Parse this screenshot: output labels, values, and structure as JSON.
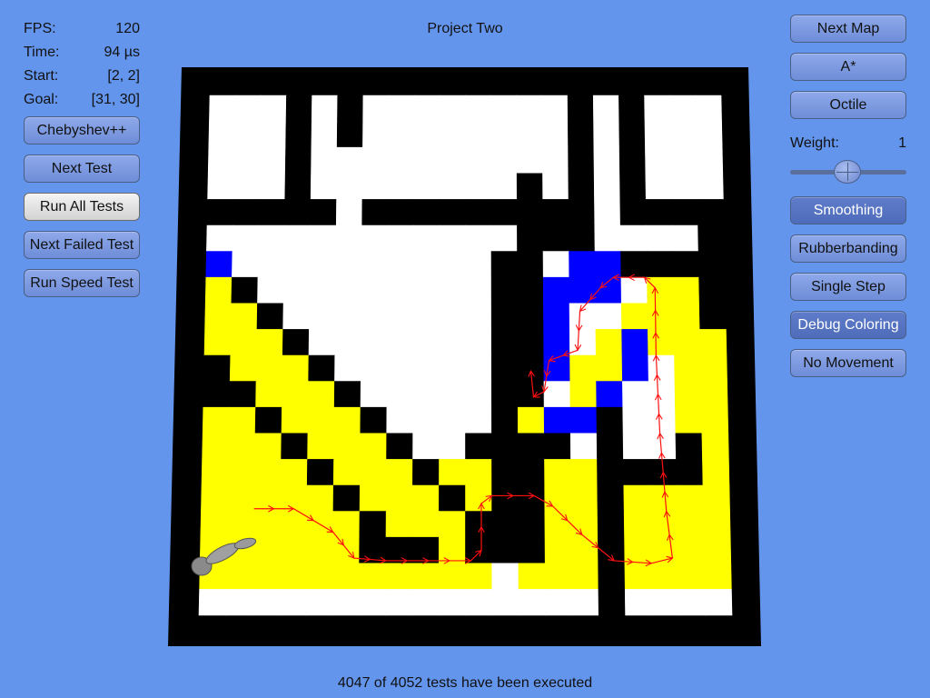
{
  "window": {
    "title": "Project Two"
  },
  "stats": [
    {
      "label": "FPS:",
      "value": "120"
    },
    {
      "label": "Time:",
      "value": "94 µs"
    },
    {
      "label": "Start:",
      "value": "[2, 2]"
    },
    {
      "label": "Goal:",
      "value": "[31, 30]"
    }
  ],
  "left_buttons": {
    "heuristic": "Chebyshev++",
    "next_test": "Next Test",
    "run_all_tests": "Run All Tests",
    "next_failed_test": "Next Failed Test",
    "run_speed_test": "Run Speed Test"
  },
  "right_panel": {
    "next_map": "Next Map",
    "algorithm": "A*",
    "heuristic_mode": "Octile",
    "weight_label": "Weight:",
    "weight_value": "1",
    "weight_slider_fraction": 0.43,
    "smoothing": "Smoothing",
    "rubberbanding": "Rubberbanding",
    "single_step": "Single Step",
    "debug_coloring": "Debug Coloring",
    "no_movement": "No Movement"
  },
  "status": {
    "text": "4047 of 4052 tests have been executed"
  },
  "colors": {
    "background": "#6495ed",
    "wall": "#000000",
    "open": "#ffffff",
    "closed": "#ffff00",
    "frontier": "#0000ff",
    "path": "#ff1010"
  },
  "grid": {
    "size": 20,
    "walls": [
      "14,0",
      "14,1",
      "14,2",
      "14,3",
      "14,4",
      "14,5",
      "12,3",
      "12,4",
      "12,5",
      "12,6",
      "12,7",
      "12,8",
      "12,9",
      "12,10",
      "12,11",
      "16,0",
      "16,1",
      "16,2",
      "16,3",
      "16,4",
      "11,6",
      "11,7",
      "11,8",
      "11,9",
      "11,10",
      "11,11",
      "11,12",
      "11,13",
      "11,14",
      "11,15",
      "11,16",
      "11,17",
      "12,14",
      "12,15",
      "12,16",
      "12,17",
      "10,16",
      "10,17",
      "15,12",
      "15,13",
      "15,14",
      "15,15",
      "15,16",
      "15,17",
      "15,18",
      "15,19",
      "16,6",
      "17,6",
      "18,6",
      "19,6",
      "19,7",
      "19,8",
      "3,0",
      "3,1",
      "3,2",
      "3,3",
      "3,4",
      "0,4",
      "1,4",
      "2,4",
      "3,4",
      "4,4",
      "6,4",
      "7,4",
      "8,4",
      "9,4",
      "10,4",
      "11,4",
      "12,4",
      "13,4",
      "14,4",
      "12,5",
      "13,5",
      "5,0",
      "5,1",
      "17,4",
      "18,4",
      "19,4",
      "19,5",
      "1,7",
      "2,8",
      "3,9",
      "4,10",
      "5,11",
      "6,12",
      "7,13",
      "8,14",
      "9,15",
      "0,10",
      "1,11",
      "2,12",
      "3,13",
      "4,14",
      "5,15",
      "6,16",
      "6,17",
      "7,17",
      "8,17",
      "6,16",
      "8,17",
      "10,13",
      "11,13",
      "12,13",
      "13,13",
      "18,13",
      "18,14",
      "17,14",
      "16,14",
      "0,11"
    ],
    "closed": [
      "0,7",
      "0,8",
      "0,9",
      "0,11",
      "0,12",
      "0,13",
      "0,14",
      "0,15",
      "0,16",
      "0,17",
      "0,18",
      "1,8",
      "1,9",
      "1,10",
      "1,12",
      "1,13",
      "1,14",
      "1,15",
      "1,16",
      "1,17",
      "1,18",
      "2,9",
      "2,10",
      "2,11",
      "2,13",
      "2,14",
      "2,15",
      "2,16",
      "2,17",
      "2,18",
      "3,10",
      "3,11",
      "3,12",
      "3,14",
      "3,15",
      "3,16",
      "3,17",
      "3,18",
      "4,11",
      "4,12",
      "4,13",
      "4,15",
      "4,16",
      "4,17",
      "4,18",
      "5,12",
      "5,13",
      "5,14",
      "5,16",
      "5,17",
      "5,18",
      "6,13",
      "6,14",
      "6,15",
      "6,18",
      "7,14",
      "7,15",
      "7,16",
      "7,18",
      "8,15",
      "8,16",
      "8,18",
      "9,14",
      "9,16",
      "9,17",
      "9,18",
      "10,14",
      "10,15",
      "10,18",
      "11,14",
      "11,15",
      "12,15",
      "12,16",
      "12,17",
      "12,18",
      "13,14",
      "13,15",
      "13,16",
      "13,17",
      "13,18",
      "14,14",
      "14,15",
      "14,16",
      "14,17",
      "14,18",
      "16,15",
      "16,16",
      "16,17",
      "16,18",
      "17,15",
      "17,16",
      "17,17",
      "17,18",
      "18,15",
      "18,16",
      "18,17",
      "18,18",
      "19,9",
      "19,10",
      "19,11",
      "19,12",
      "19,13",
      "19,14",
      "19,15",
      "19,16",
      "19,17",
      "19,18",
      "17,7",
      "17,8",
      "17,9",
      "18,7",
      "18,8",
      "18,9",
      "18,10",
      "18,11",
      "18,12",
      "16,8",
      "16,9",
      "15,9",
      "15,10",
      "14,10",
      "14,11",
      "12,12",
      "13,12",
      "14,12"
    ],
    "frontier": [
      "14,6",
      "15,6",
      "14,7",
      "15,7",
      "13,7",
      "13,8",
      "12,8",
      "12,9",
      "11,9",
      "11,10",
      "11,11",
      "13,9",
      "13,10",
      "12,10",
      "16,9",
      "16,10",
      "15,11",
      "14,12",
      "13,12",
      "17,6",
      "18,6",
      "0,6"
    ]
  }
}
